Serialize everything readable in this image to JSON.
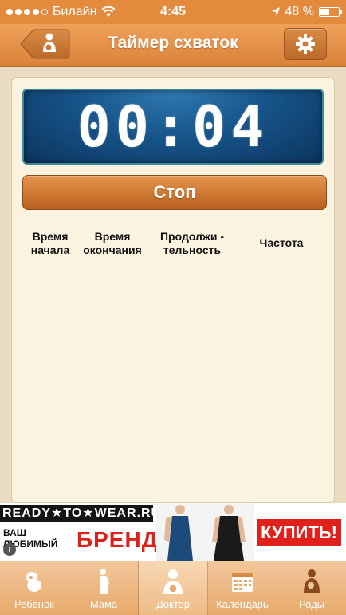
{
  "status_bar": {
    "carrier": "Билайн",
    "time": "4:45",
    "battery": "48 %",
    "battery_level": 0.48
  },
  "nav": {
    "title": "Таймер схваток"
  },
  "timer": {
    "display": "00:04"
  },
  "stop_button": "Стоп",
  "table": {
    "columns": [
      {
        "line1": "Время",
        "line2": "начала"
      },
      {
        "line1": "Время",
        "line2": "окончания"
      },
      {
        "line1": "Продолжи -",
        "line2": "тельность"
      },
      {
        "line1": "Частота",
        "line2": ""
      }
    ]
  },
  "banner": {
    "brand": "READY★TO★WEAR.RU",
    "sub": "ВАШ ЛЮБИМЫЙ",
    "big": "БРЕНД",
    "cta": "КУПИТЬ!",
    "info": "i"
  },
  "tabs": [
    {
      "label": "Ребенок",
      "icon": "fetus-icon"
    },
    {
      "label": "Мама",
      "icon": "pregnant-woman-icon"
    },
    {
      "label": "Доктор",
      "icon": "doctor-icon"
    },
    {
      "label": "Календарь",
      "icon": "calendar-icon"
    },
    {
      "label": "Роды",
      "icon": "mother-baby-icon"
    }
  ],
  "colors": {
    "accent": "#e48a3c",
    "timer_bg": "#17558a",
    "banner_red": "#e0201b"
  }
}
